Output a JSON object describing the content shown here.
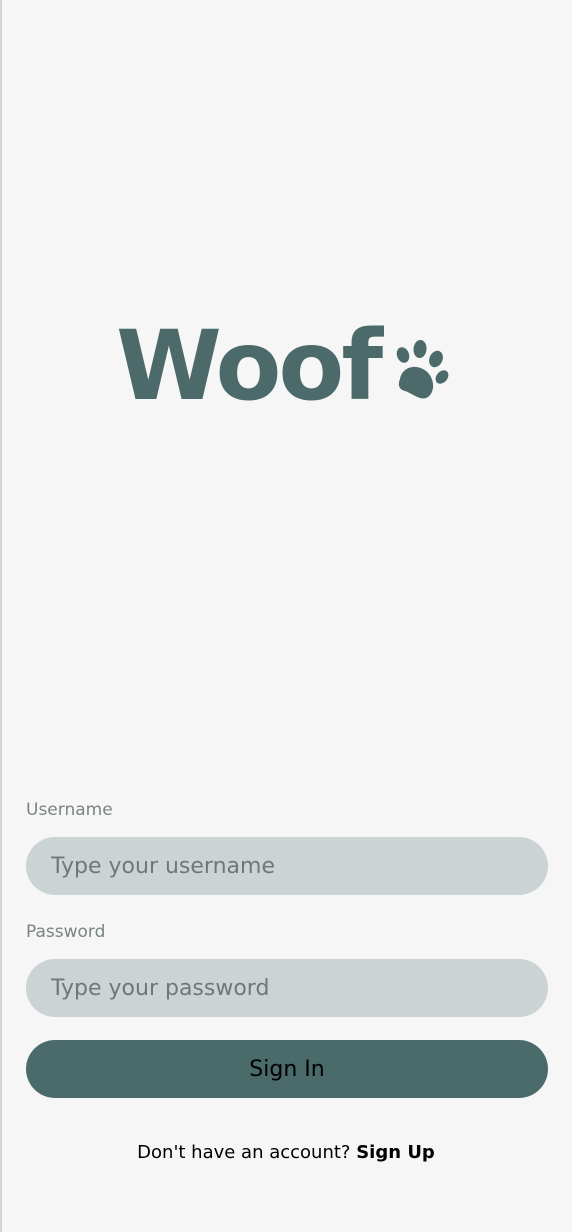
{
  "app": {
    "logo_text": "Woof",
    "logo_icon": "paw-icon",
    "brand_color": "#4b6a69"
  },
  "login": {
    "username_label": "Username",
    "username_placeholder": "Type your username",
    "username_value": "",
    "password_label": "Password",
    "password_placeholder": "Type your password",
    "password_value": "",
    "sign_in_label": "Sign In",
    "signup_prompt": "Don't have an account?",
    "signup_link": "Sign Up"
  },
  "colors": {
    "background": "#f6f6f6",
    "input_background": "#ccd3d5",
    "button_background": "#4a6b6a"
  }
}
